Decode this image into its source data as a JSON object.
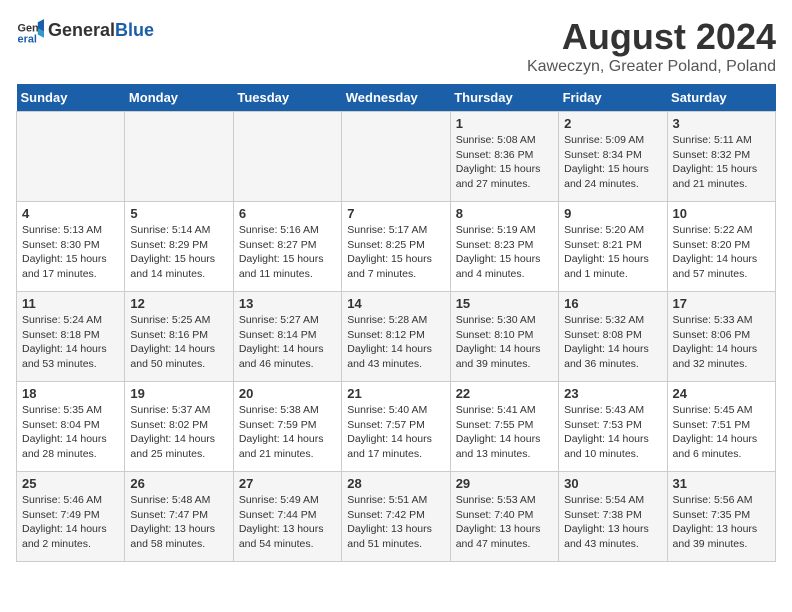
{
  "header": {
    "logo_general": "General",
    "logo_blue": "Blue",
    "title": "August 2024",
    "subtitle": "Kaweczyn, Greater Poland, Poland"
  },
  "days_of_week": [
    "Sunday",
    "Monday",
    "Tuesday",
    "Wednesday",
    "Thursday",
    "Friday",
    "Saturday"
  ],
  "weeks": [
    [
      {
        "day": "",
        "info": ""
      },
      {
        "day": "",
        "info": ""
      },
      {
        "day": "",
        "info": ""
      },
      {
        "day": "",
        "info": ""
      },
      {
        "day": "1",
        "info": "Sunrise: 5:08 AM\nSunset: 8:36 PM\nDaylight: 15 hours\nand 27 minutes."
      },
      {
        "day": "2",
        "info": "Sunrise: 5:09 AM\nSunset: 8:34 PM\nDaylight: 15 hours\nand 24 minutes."
      },
      {
        "day": "3",
        "info": "Sunrise: 5:11 AM\nSunset: 8:32 PM\nDaylight: 15 hours\nand 21 minutes."
      }
    ],
    [
      {
        "day": "4",
        "info": "Sunrise: 5:13 AM\nSunset: 8:30 PM\nDaylight: 15 hours\nand 17 minutes."
      },
      {
        "day": "5",
        "info": "Sunrise: 5:14 AM\nSunset: 8:29 PM\nDaylight: 15 hours\nand 14 minutes."
      },
      {
        "day": "6",
        "info": "Sunrise: 5:16 AM\nSunset: 8:27 PM\nDaylight: 15 hours\nand 11 minutes."
      },
      {
        "day": "7",
        "info": "Sunrise: 5:17 AM\nSunset: 8:25 PM\nDaylight: 15 hours\nand 7 minutes."
      },
      {
        "day": "8",
        "info": "Sunrise: 5:19 AM\nSunset: 8:23 PM\nDaylight: 15 hours\nand 4 minutes."
      },
      {
        "day": "9",
        "info": "Sunrise: 5:20 AM\nSunset: 8:21 PM\nDaylight: 15 hours\nand 1 minute."
      },
      {
        "day": "10",
        "info": "Sunrise: 5:22 AM\nSunset: 8:20 PM\nDaylight: 14 hours\nand 57 minutes."
      }
    ],
    [
      {
        "day": "11",
        "info": "Sunrise: 5:24 AM\nSunset: 8:18 PM\nDaylight: 14 hours\nand 53 minutes."
      },
      {
        "day": "12",
        "info": "Sunrise: 5:25 AM\nSunset: 8:16 PM\nDaylight: 14 hours\nand 50 minutes."
      },
      {
        "day": "13",
        "info": "Sunrise: 5:27 AM\nSunset: 8:14 PM\nDaylight: 14 hours\nand 46 minutes."
      },
      {
        "day": "14",
        "info": "Sunrise: 5:28 AM\nSunset: 8:12 PM\nDaylight: 14 hours\nand 43 minutes."
      },
      {
        "day": "15",
        "info": "Sunrise: 5:30 AM\nSunset: 8:10 PM\nDaylight: 14 hours\nand 39 minutes."
      },
      {
        "day": "16",
        "info": "Sunrise: 5:32 AM\nSunset: 8:08 PM\nDaylight: 14 hours\nand 36 minutes."
      },
      {
        "day": "17",
        "info": "Sunrise: 5:33 AM\nSunset: 8:06 PM\nDaylight: 14 hours\nand 32 minutes."
      }
    ],
    [
      {
        "day": "18",
        "info": "Sunrise: 5:35 AM\nSunset: 8:04 PM\nDaylight: 14 hours\nand 28 minutes."
      },
      {
        "day": "19",
        "info": "Sunrise: 5:37 AM\nSunset: 8:02 PM\nDaylight: 14 hours\nand 25 minutes."
      },
      {
        "day": "20",
        "info": "Sunrise: 5:38 AM\nSunset: 7:59 PM\nDaylight: 14 hours\nand 21 minutes."
      },
      {
        "day": "21",
        "info": "Sunrise: 5:40 AM\nSunset: 7:57 PM\nDaylight: 14 hours\nand 17 minutes."
      },
      {
        "day": "22",
        "info": "Sunrise: 5:41 AM\nSunset: 7:55 PM\nDaylight: 14 hours\nand 13 minutes."
      },
      {
        "day": "23",
        "info": "Sunrise: 5:43 AM\nSunset: 7:53 PM\nDaylight: 14 hours\nand 10 minutes."
      },
      {
        "day": "24",
        "info": "Sunrise: 5:45 AM\nSunset: 7:51 PM\nDaylight: 14 hours\nand 6 minutes."
      }
    ],
    [
      {
        "day": "25",
        "info": "Sunrise: 5:46 AM\nSunset: 7:49 PM\nDaylight: 14 hours\nand 2 minutes."
      },
      {
        "day": "26",
        "info": "Sunrise: 5:48 AM\nSunset: 7:47 PM\nDaylight: 13 hours\nand 58 minutes."
      },
      {
        "day": "27",
        "info": "Sunrise: 5:49 AM\nSunset: 7:44 PM\nDaylight: 13 hours\nand 54 minutes."
      },
      {
        "day": "28",
        "info": "Sunrise: 5:51 AM\nSunset: 7:42 PM\nDaylight: 13 hours\nand 51 minutes."
      },
      {
        "day": "29",
        "info": "Sunrise: 5:53 AM\nSunset: 7:40 PM\nDaylight: 13 hours\nand 47 minutes."
      },
      {
        "day": "30",
        "info": "Sunrise: 5:54 AM\nSunset: 7:38 PM\nDaylight: 13 hours\nand 43 minutes."
      },
      {
        "day": "31",
        "info": "Sunrise: 5:56 AM\nSunset: 7:35 PM\nDaylight: 13 hours\nand 39 minutes."
      }
    ]
  ]
}
